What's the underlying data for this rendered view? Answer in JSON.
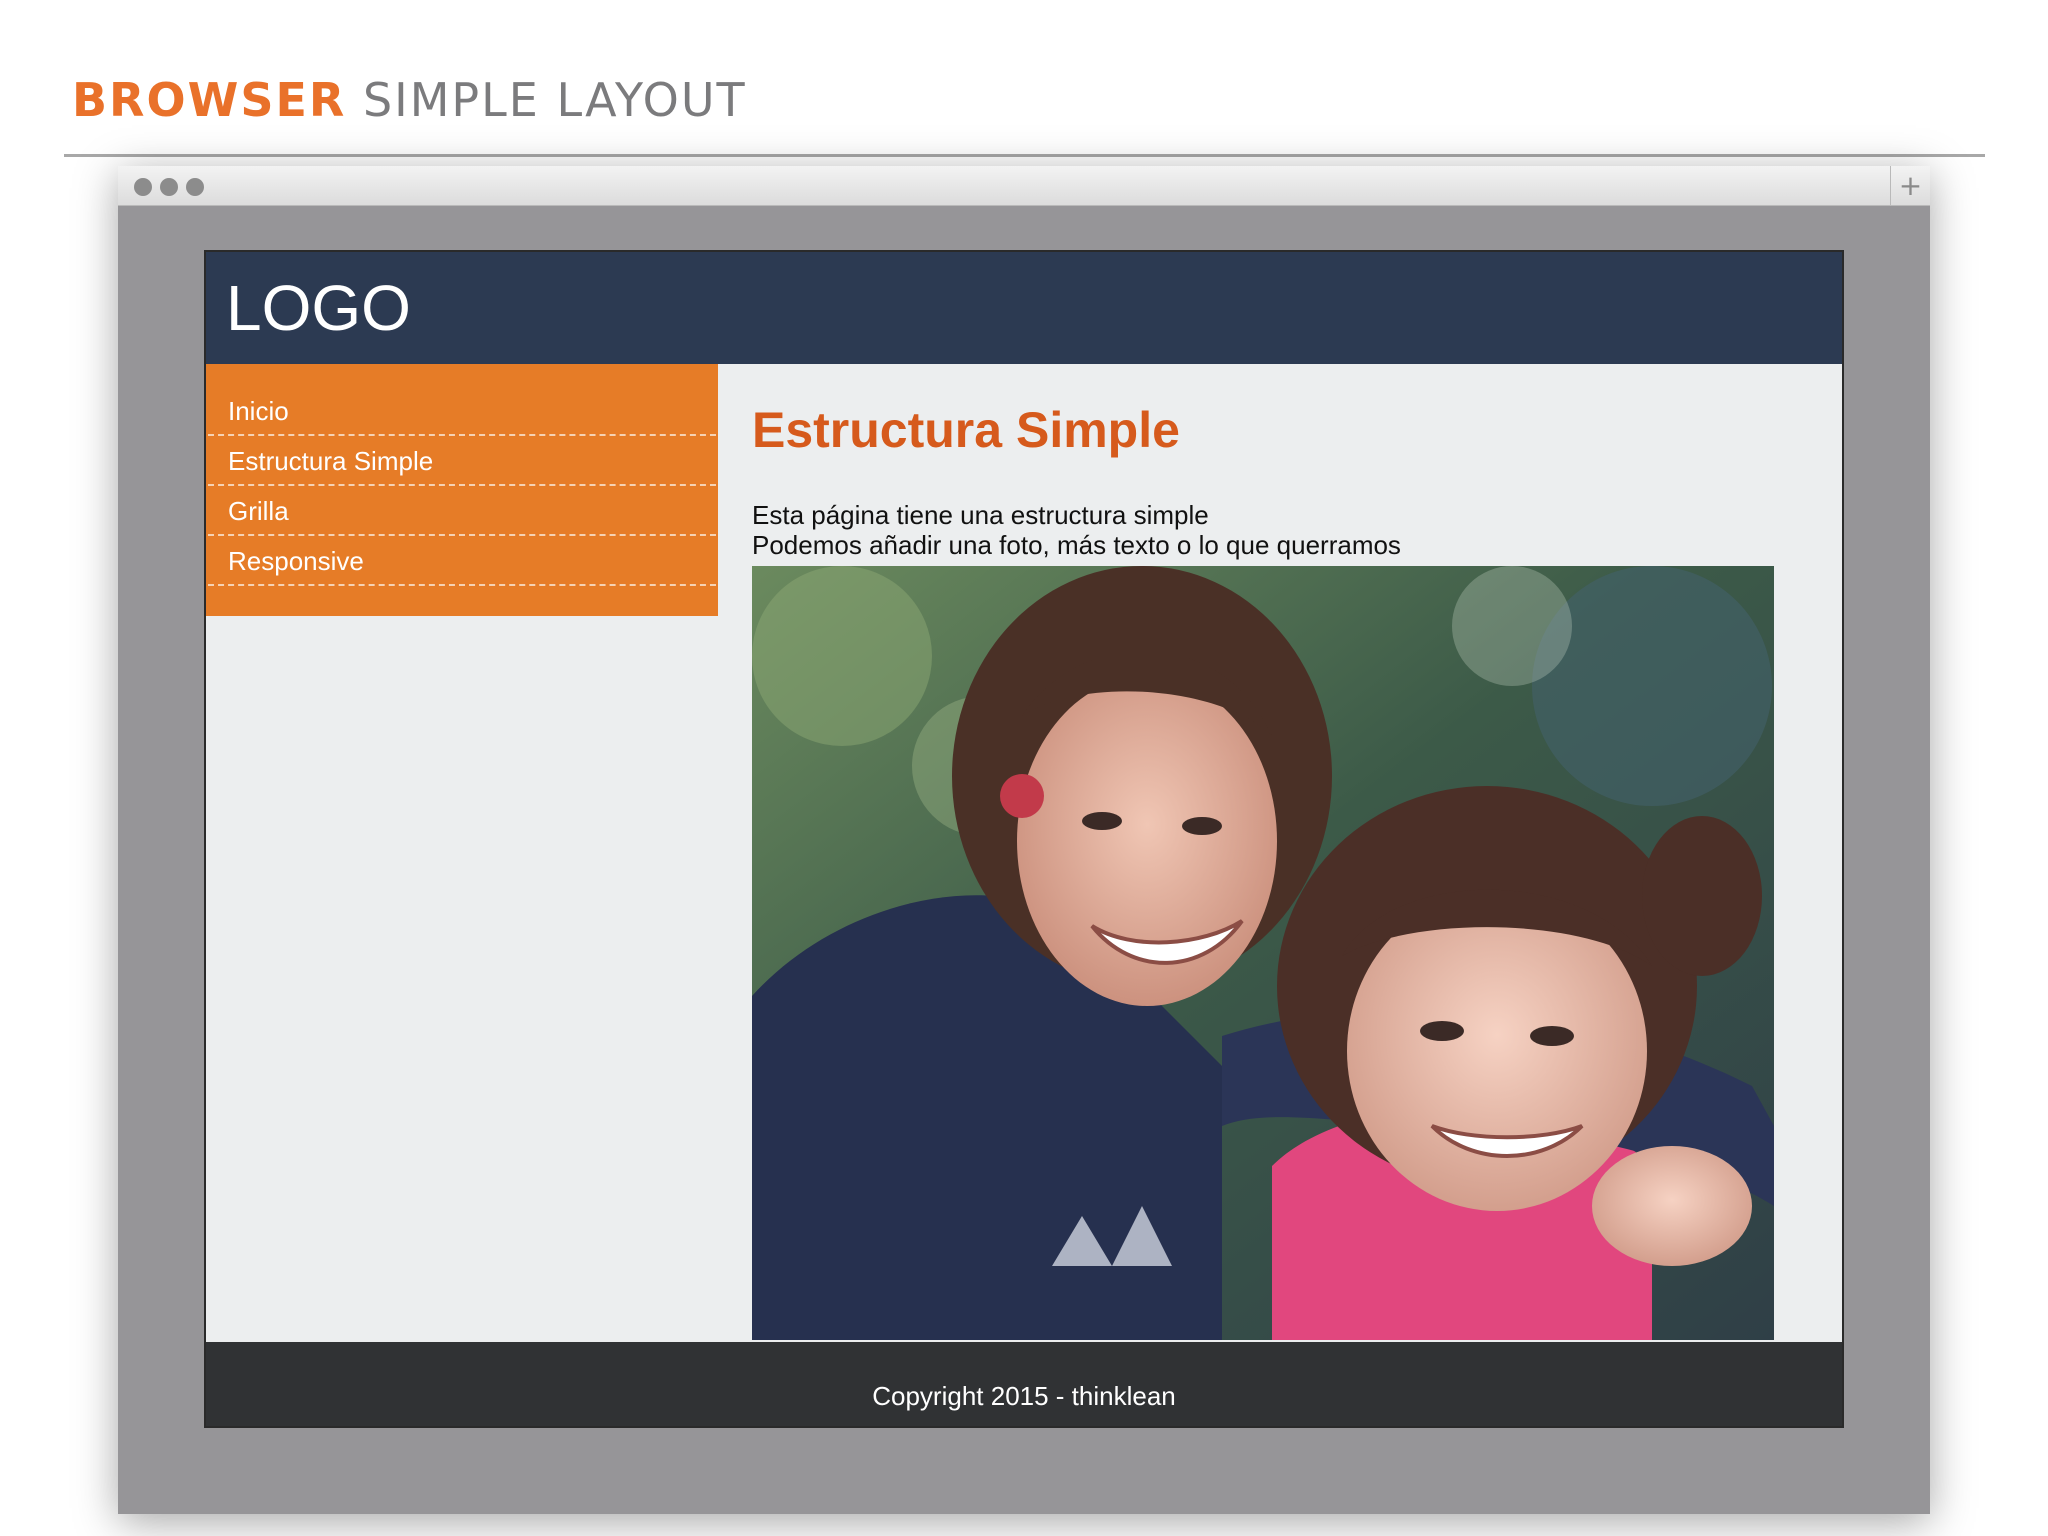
{
  "slide": {
    "title_accent": "BROWSER",
    "title_rest": "SIMPLE LAYOUT",
    "accent_color": "#e9712a"
  },
  "browser": {
    "new_tab_icon": "+"
  },
  "site": {
    "logo": "LOGO",
    "header_color": "#2c3a52",
    "nav_color": "#e67c27",
    "nav": [
      {
        "label": "Inicio"
      },
      {
        "label": "Estructura Simple"
      },
      {
        "label": "Grilla"
      },
      {
        "label": "Responsive"
      }
    ],
    "content": {
      "title": "Estructura Simple",
      "title_color": "#d65a1c",
      "lines": [
        "Esta página tiene una estructura simple",
        "Podemos añadir una foto, más texto o lo que querramos"
      ]
    },
    "footer": "Copyright 2015 - thinklean"
  }
}
